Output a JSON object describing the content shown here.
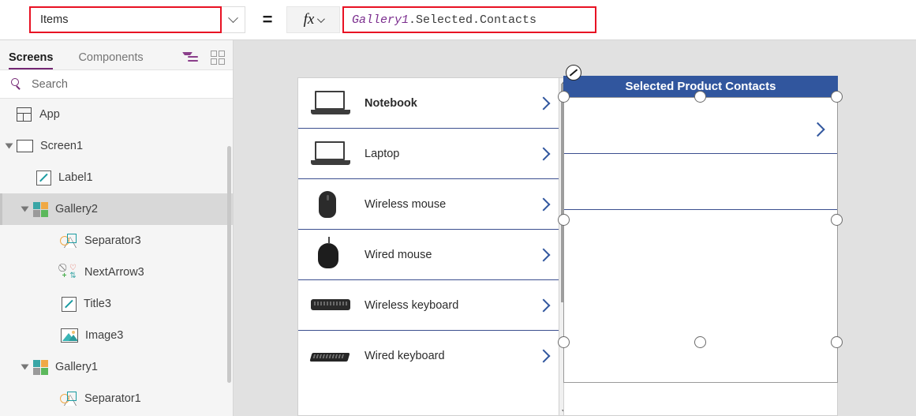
{
  "formula_bar": {
    "property_value": "Items",
    "equals": "=",
    "fx_label": "fx",
    "formula_tokens": {
      "identifier": "Gallery1",
      "rest": ".Selected.Contacts"
    },
    "formula_full": "Gallery1.Selected.Contacts",
    "dropdown_icon": "chevron-down-icon",
    "fx_chevron_icon": "chevron-down-icon",
    "highlight_color": "#e81123",
    "identifier_color": "#7b2d8e"
  },
  "left_panel": {
    "tabs": [
      {
        "label": "Screens",
        "active": true
      },
      {
        "label": "Components",
        "active": false
      }
    ],
    "view_icons": [
      {
        "name": "tree-view-icon",
        "color": "#8b3f8b"
      },
      {
        "name": "thumbnail-view-icon",
        "color": "#9a9a9a"
      }
    ],
    "search": {
      "placeholder": "Search",
      "value": "",
      "icon": "search-icon"
    },
    "tree_items": [
      {
        "label": "App",
        "icon": "app-icon",
        "indent": 0,
        "expander": "none",
        "selected": false
      },
      {
        "label": "Screen1",
        "icon": "screen-icon",
        "indent": 0,
        "expander": "expanded",
        "selected": false
      },
      {
        "label": "Label1",
        "icon": "label-icon",
        "indent": 1,
        "expander": "none",
        "selected": false
      },
      {
        "label": "Gallery2",
        "icon": "gallery-icon",
        "indent": 1,
        "expander": "expanded",
        "selected": true
      },
      {
        "label": "Separator3",
        "icon": "separator-icon",
        "indent": 2,
        "expander": "none",
        "selected": false
      },
      {
        "label": "NextArrow3",
        "icon": "icons-icon",
        "indent": 2,
        "expander": "none",
        "selected": false
      },
      {
        "label": "Title3",
        "icon": "label-icon",
        "indent": 2,
        "expander": "none",
        "selected": false
      },
      {
        "label": "Image3",
        "icon": "image-icon",
        "indent": 2,
        "expander": "none",
        "selected": false
      },
      {
        "label": "Gallery1",
        "icon": "gallery-icon",
        "indent": 1,
        "expander": "expanded",
        "selected": false
      },
      {
        "label": "Separator1",
        "icon": "separator-icon",
        "indent": 2,
        "expander": "none",
        "selected": false
      }
    ]
  },
  "canvas": {
    "background_color": "#e1e1e1",
    "gallery1": {
      "name": "Gallery1",
      "items": [
        {
          "title": "Notebook",
          "thumb": "laptop-thumbnail",
          "bold": true
        },
        {
          "title": "Laptop",
          "thumb": "laptop-thumbnail",
          "bold": false
        },
        {
          "title": "Wireless mouse",
          "thumb": "wireless-mouse-thumbnail",
          "bold": false
        },
        {
          "title": "Wired mouse",
          "thumb": "wired-mouse-thumbnail",
          "bold": false
        },
        {
          "title": "Wireless keyboard",
          "thumb": "wireless-keyboard-thumbnail",
          "bold": false
        },
        {
          "title": "Wired keyboard",
          "thumb": "wired-keyboard-thumbnail",
          "bold": false
        }
      ],
      "arrow_icon": "chevron-right-icon",
      "arrow_color": "#31569e",
      "scrollbar": {
        "name": "vertical-scrollbar",
        "up_icon": "caret-up-icon",
        "down_icon": "caret-down-icon"
      }
    },
    "banner": {
      "text": "Selected Product Contacts",
      "background_color": "#31569e",
      "text_color": "#ffffff"
    },
    "gallery2": {
      "name": "Gallery2",
      "selected": true,
      "items": [
        {
          "title": "",
          "arrow_icon": "chevron-right-icon"
        },
        {
          "title": ""
        },
        {
          "title": ""
        }
      ],
      "edit_badge_icon": "pencil-edit-icon",
      "handles": [
        "handle-top-left",
        "handle-top-center",
        "handle-top-right",
        "handle-middle-left",
        "handle-middle-right",
        "handle-bottom-left",
        "handle-bottom-center",
        "handle-bottom-right"
      ]
    }
  }
}
